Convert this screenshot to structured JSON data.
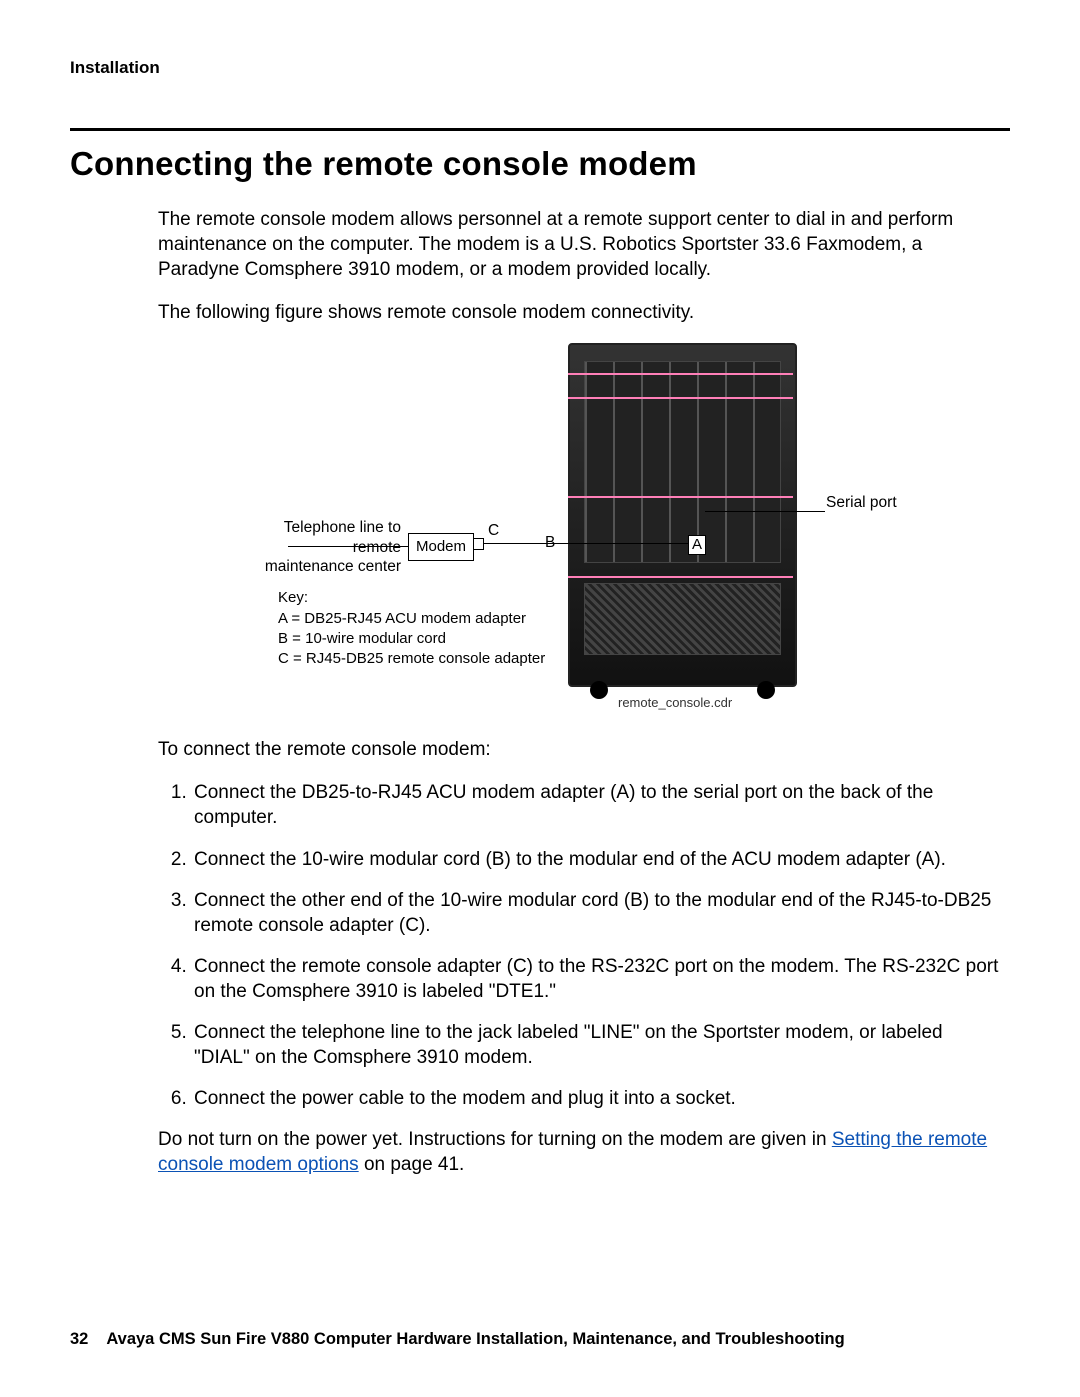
{
  "running_head": "Installation",
  "title": "Connecting the remote console modem",
  "intro_p1": "The remote console modem allows personnel at a remote support center to dial in and perform maintenance on the computer. The modem is a U.S. Robotics Sportster 33.6 Faxmodem, a Paradyne Comsphere 3910 modem, or a modem provided locally.",
  "intro_p2": "The following figure shows remote console modem connectivity.",
  "figure": {
    "serial_port": "Serial port",
    "telephone": "Telephone line to remote maintenance center",
    "modem_box": "Modem",
    "ptA": "A",
    "ptB": "B",
    "ptC": "C",
    "key_title": "Key:",
    "key_a": "A = DB25-RJ45 ACU modem adapter",
    "key_b": "B = 10-wire modular cord",
    "key_c": "C = RJ45-DB25 remote console adapter",
    "filename": "remote_console.cdr"
  },
  "lead_in": "To connect the remote console modem:",
  "steps": [
    "Connect the DB25-to-RJ45 ACU modem adapter (A) to the serial port on the back of the computer.",
    "Connect the 10-wire modular cord (B) to the modular end of the ACU modem adapter (A).",
    "Connect the other end of the 10-wire modular cord (B) to the modular end of the RJ45-to-DB25 remote console adapter (C).",
    "Connect the remote console adapter (C) to the RS-232C port on the modem. The RS-232C port on the Comsphere 3910 is labeled \"DTE1.\"",
    "Connect the telephone line to the jack labeled \"LINE\" on the Sportster modem, or labeled \"DIAL\" on the Comsphere 3910 modem.",
    "Connect the power cable to the modem and plug it into a socket."
  ],
  "closing_pre": "Do not turn on the power yet. Instructions for turning on the modem are given in ",
  "closing_link": "Setting the remote console modem options",
  "closing_post": " on page 41.",
  "footer": {
    "page": "32",
    "doc": "Avaya CMS Sun Fire V880 Computer Hardware Installation, Maintenance, and Troubleshooting"
  }
}
